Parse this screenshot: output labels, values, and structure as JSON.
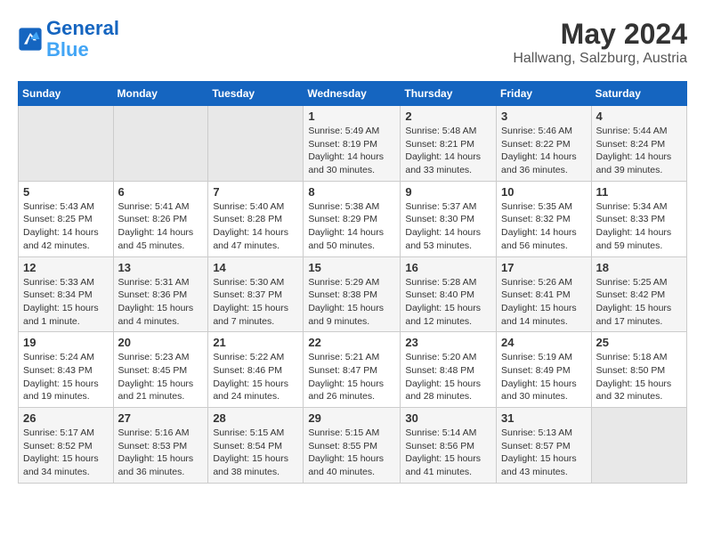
{
  "header": {
    "logo_line1": "General",
    "logo_line2": "Blue",
    "title": "May 2024",
    "subtitle": "Hallwang, Salzburg, Austria"
  },
  "days_of_week": [
    "Sunday",
    "Monday",
    "Tuesday",
    "Wednesday",
    "Thursday",
    "Friday",
    "Saturday"
  ],
  "weeks": [
    [
      {
        "num": "",
        "info": ""
      },
      {
        "num": "",
        "info": ""
      },
      {
        "num": "",
        "info": ""
      },
      {
        "num": "1",
        "info": "Sunrise: 5:49 AM\nSunset: 8:19 PM\nDaylight: 14 hours\nand 30 minutes."
      },
      {
        "num": "2",
        "info": "Sunrise: 5:48 AM\nSunset: 8:21 PM\nDaylight: 14 hours\nand 33 minutes."
      },
      {
        "num": "3",
        "info": "Sunrise: 5:46 AM\nSunset: 8:22 PM\nDaylight: 14 hours\nand 36 minutes."
      },
      {
        "num": "4",
        "info": "Sunrise: 5:44 AM\nSunset: 8:24 PM\nDaylight: 14 hours\nand 39 minutes."
      }
    ],
    [
      {
        "num": "5",
        "info": "Sunrise: 5:43 AM\nSunset: 8:25 PM\nDaylight: 14 hours\nand 42 minutes."
      },
      {
        "num": "6",
        "info": "Sunrise: 5:41 AM\nSunset: 8:26 PM\nDaylight: 14 hours\nand 45 minutes."
      },
      {
        "num": "7",
        "info": "Sunrise: 5:40 AM\nSunset: 8:28 PM\nDaylight: 14 hours\nand 47 minutes."
      },
      {
        "num": "8",
        "info": "Sunrise: 5:38 AM\nSunset: 8:29 PM\nDaylight: 14 hours\nand 50 minutes."
      },
      {
        "num": "9",
        "info": "Sunrise: 5:37 AM\nSunset: 8:30 PM\nDaylight: 14 hours\nand 53 minutes."
      },
      {
        "num": "10",
        "info": "Sunrise: 5:35 AM\nSunset: 8:32 PM\nDaylight: 14 hours\nand 56 minutes."
      },
      {
        "num": "11",
        "info": "Sunrise: 5:34 AM\nSunset: 8:33 PM\nDaylight: 14 hours\nand 59 minutes."
      }
    ],
    [
      {
        "num": "12",
        "info": "Sunrise: 5:33 AM\nSunset: 8:34 PM\nDaylight: 15 hours\nand 1 minute."
      },
      {
        "num": "13",
        "info": "Sunrise: 5:31 AM\nSunset: 8:36 PM\nDaylight: 15 hours\nand 4 minutes."
      },
      {
        "num": "14",
        "info": "Sunrise: 5:30 AM\nSunset: 8:37 PM\nDaylight: 15 hours\nand 7 minutes."
      },
      {
        "num": "15",
        "info": "Sunrise: 5:29 AM\nSunset: 8:38 PM\nDaylight: 15 hours\nand 9 minutes."
      },
      {
        "num": "16",
        "info": "Sunrise: 5:28 AM\nSunset: 8:40 PM\nDaylight: 15 hours\nand 12 minutes."
      },
      {
        "num": "17",
        "info": "Sunrise: 5:26 AM\nSunset: 8:41 PM\nDaylight: 15 hours\nand 14 minutes."
      },
      {
        "num": "18",
        "info": "Sunrise: 5:25 AM\nSunset: 8:42 PM\nDaylight: 15 hours\nand 17 minutes."
      }
    ],
    [
      {
        "num": "19",
        "info": "Sunrise: 5:24 AM\nSunset: 8:43 PM\nDaylight: 15 hours\nand 19 minutes."
      },
      {
        "num": "20",
        "info": "Sunrise: 5:23 AM\nSunset: 8:45 PM\nDaylight: 15 hours\nand 21 minutes."
      },
      {
        "num": "21",
        "info": "Sunrise: 5:22 AM\nSunset: 8:46 PM\nDaylight: 15 hours\nand 24 minutes."
      },
      {
        "num": "22",
        "info": "Sunrise: 5:21 AM\nSunset: 8:47 PM\nDaylight: 15 hours\nand 26 minutes."
      },
      {
        "num": "23",
        "info": "Sunrise: 5:20 AM\nSunset: 8:48 PM\nDaylight: 15 hours\nand 28 minutes."
      },
      {
        "num": "24",
        "info": "Sunrise: 5:19 AM\nSunset: 8:49 PM\nDaylight: 15 hours\nand 30 minutes."
      },
      {
        "num": "25",
        "info": "Sunrise: 5:18 AM\nSunset: 8:50 PM\nDaylight: 15 hours\nand 32 minutes."
      }
    ],
    [
      {
        "num": "26",
        "info": "Sunrise: 5:17 AM\nSunset: 8:52 PM\nDaylight: 15 hours\nand 34 minutes."
      },
      {
        "num": "27",
        "info": "Sunrise: 5:16 AM\nSunset: 8:53 PM\nDaylight: 15 hours\nand 36 minutes."
      },
      {
        "num": "28",
        "info": "Sunrise: 5:15 AM\nSunset: 8:54 PM\nDaylight: 15 hours\nand 38 minutes."
      },
      {
        "num": "29",
        "info": "Sunrise: 5:15 AM\nSunset: 8:55 PM\nDaylight: 15 hours\nand 40 minutes."
      },
      {
        "num": "30",
        "info": "Sunrise: 5:14 AM\nSunset: 8:56 PM\nDaylight: 15 hours\nand 41 minutes."
      },
      {
        "num": "31",
        "info": "Sunrise: 5:13 AM\nSunset: 8:57 PM\nDaylight: 15 hours\nand 43 minutes."
      },
      {
        "num": "",
        "info": ""
      }
    ]
  ]
}
